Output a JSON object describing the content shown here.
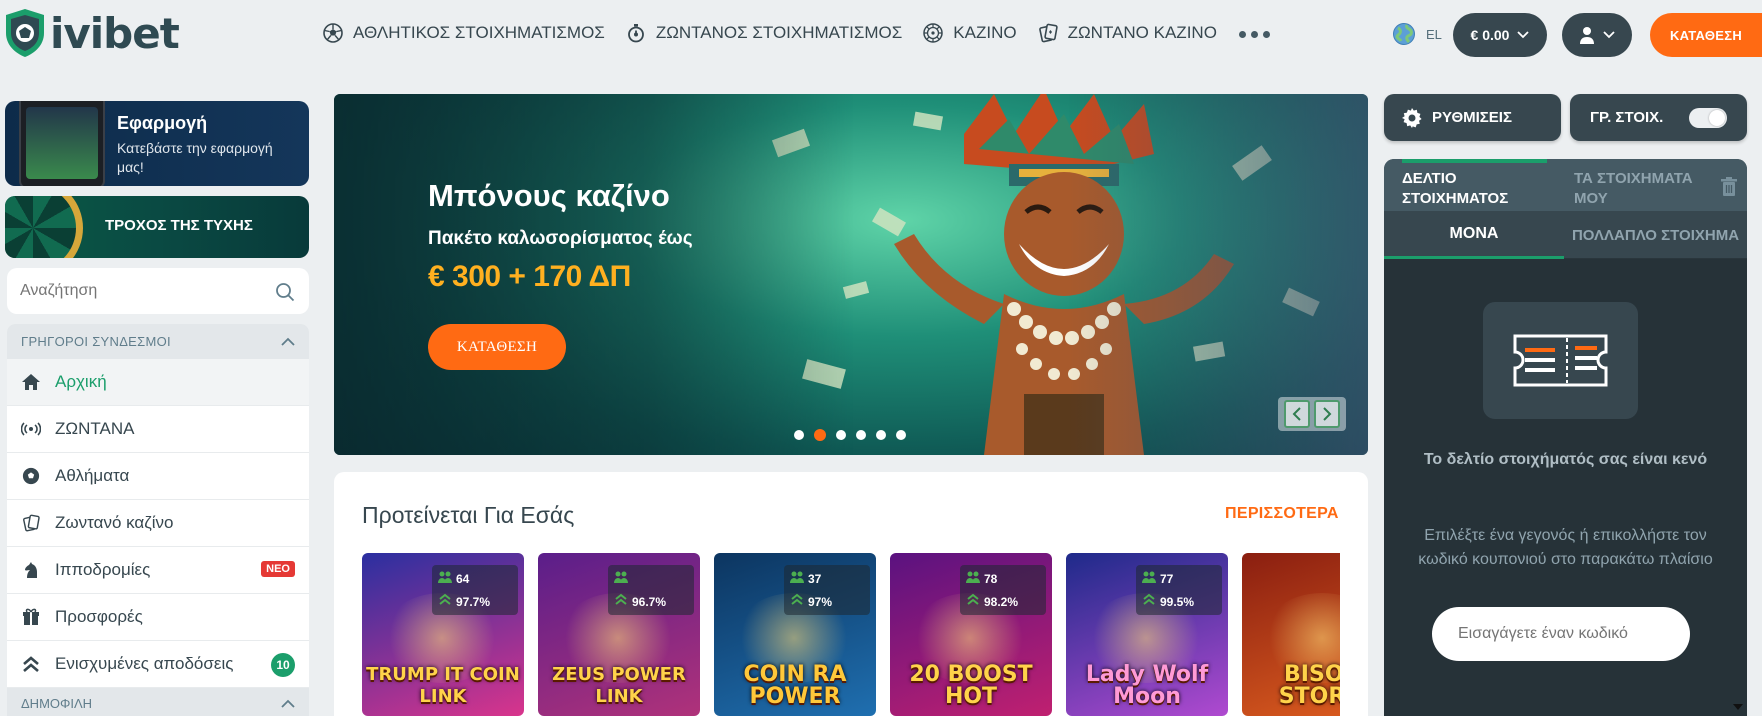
{
  "brand": {
    "name": "ivibet"
  },
  "nav": [
    {
      "label": "ΑΘΛΗΤΙΚΟΣ ΣΤΟΙΧΗΜΑΤΙΣΜΟΣ",
      "icon": "soccer-ball-icon"
    },
    {
      "label": "ΖΩΝΤΑΝΟΣ ΣΤΟΙΧΗΜΑΤΙΣΜΟΣ",
      "icon": "stopwatch-icon"
    },
    {
      "label": "ΚΑΖΙΝΟ",
      "icon": "roulette-icon"
    },
    {
      "label": "ΖΩΝΤΑΝΟ ΚΑΖΙΝΟ",
      "icon": "cards-icon"
    }
  ],
  "header": {
    "language": "EL",
    "balance": "€ 0.00",
    "deposit_label": "ΚΑΤΑΘΕΣΗ"
  },
  "sidebar": {
    "app_promo": {
      "title": "Εφαρμογή",
      "subtitle": "Κατεβάστε την εφαρμογή μας!"
    },
    "wheel_promo": {
      "title": "ΤΡΟΧΟΣ ΤΗΣ ΤΥΧΗΣ"
    },
    "search_placeholder": "Αναζήτηση",
    "quick_links_title": "ΓΡΗΓΟΡΟΙ ΣΥΝΔΕΣΜΟΙ",
    "items": [
      {
        "label": "Αρχική",
        "icon": "home-icon"
      },
      {
        "label": "ΖΩΝΤΑΝΑ",
        "icon": "live-broadcast-icon"
      },
      {
        "label": "Αθλήματα",
        "icon": "soccer-ball-icon"
      },
      {
        "label": "Ζωντανό καζίνο",
        "icon": "cards-icon"
      },
      {
        "label": "Ιπποδρομίες",
        "icon": "horse-icon",
        "badge": "ΝΕΟ"
      },
      {
        "label": "Προσφορές",
        "icon": "gift-icon"
      },
      {
        "label": "Ενισχυμένες αποδόσεις",
        "icon": "boost-arrows-icon",
        "count": "10"
      }
    ],
    "popular_title": "ΔΗΜΟΦΙΛΗ"
  },
  "banner": {
    "title": "Μπόνους καζίνο",
    "subtitle": "Πακέτο καλωσορίσματος έως",
    "amount": "€ 300 + 170 ΔΠ",
    "cta": "ΚΑΤΑΘΕΣΗ",
    "active_slide": 2,
    "slide_count": 6
  },
  "recommended": {
    "title": "Προτείνεται Για Εσάς",
    "more_label": "ΠΕΡΙΣΣΟΤΕΡΑ",
    "games": [
      {
        "name": "TRUMP IT COIN LINK",
        "players": "64",
        "rtp": "97.7%",
        "colors": [
          "#2a2fa0",
          "#d9348c"
        ],
        "title_color": "#ffd34a"
      },
      {
        "name": "ZEUS POWER LINK",
        "players": "",
        "rtp": "96.7%",
        "colors": [
          "#5a1e8a",
          "#b0327a"
        ],
        "title_color": "#ffd34a"
      },
      {
        "name": "COIN RA POWER",
        "players": "37",
        "rtp": "97%",
        "colors": [
          "#0c3560",
          "#1f6fb0"
        ],
        "title_color": "#ffc83a"
      },
      {
        "name": "20 BOOST HOT",
        "players": "78",
        "rtp": "98.2%",
        "colors": [
          "#5a1280",
          "#c02070"
        ],
        "title_color": "#ffd34a"
      },
      {
        "name": "Lady Wolf Moon",
        "players": "77",
        "rtp": "99.5%",
        "colors": [
          "#1e2a8a",
          "#b04ad0"
        ],
        "title_color": "#ff9ad6"
      },
      {
        "name": "BISON STORM",
        "players": "",
        "rtp": "",
        "colors": [
          "#8a1e10",
          "#e06020"
        ],
        "title_color": "#ffd34a"
      }
    ]
  },
  "rightpanel": {
    "settings_label": "ΡΥΘΜΙΣΕΙΣ",
    "quickbet_label": "ΓΡ. ΣΤΟΙΧ.",
    "tab_slip": "ΔΕΛΤΙΟ ΣΤΟΙΧΗΜΑΤΟΣ",
    "tab_mybets": "ΤΑ ΣΤΟΙΧΗΜΑΤΑ ΜΟΥ",
    "tab_single": "ΜΟΝΑ",
    "tab_multiple": "ΠΟΛΛΑΠΛΟ ΣΤΟΙΧΗΜΑ",
    "empty_text": "Το δελτίο στοιχήματός σας είναι κενό",
    "hint_text": "Επιλέξτε ένα γεγονός ή επικολλήστε τον κωδικό κουπονιού στο παρακάτω πλαίσιο",
    "coupon_placeholder": "Εισαγάγετε έναν κωδικό"
  },
  "colors": {
    "accent": "#ff6a13",
    "green": "#1b9e6b",
    "dark": "#37474f",
    "panel": "#263238"
  }
}
